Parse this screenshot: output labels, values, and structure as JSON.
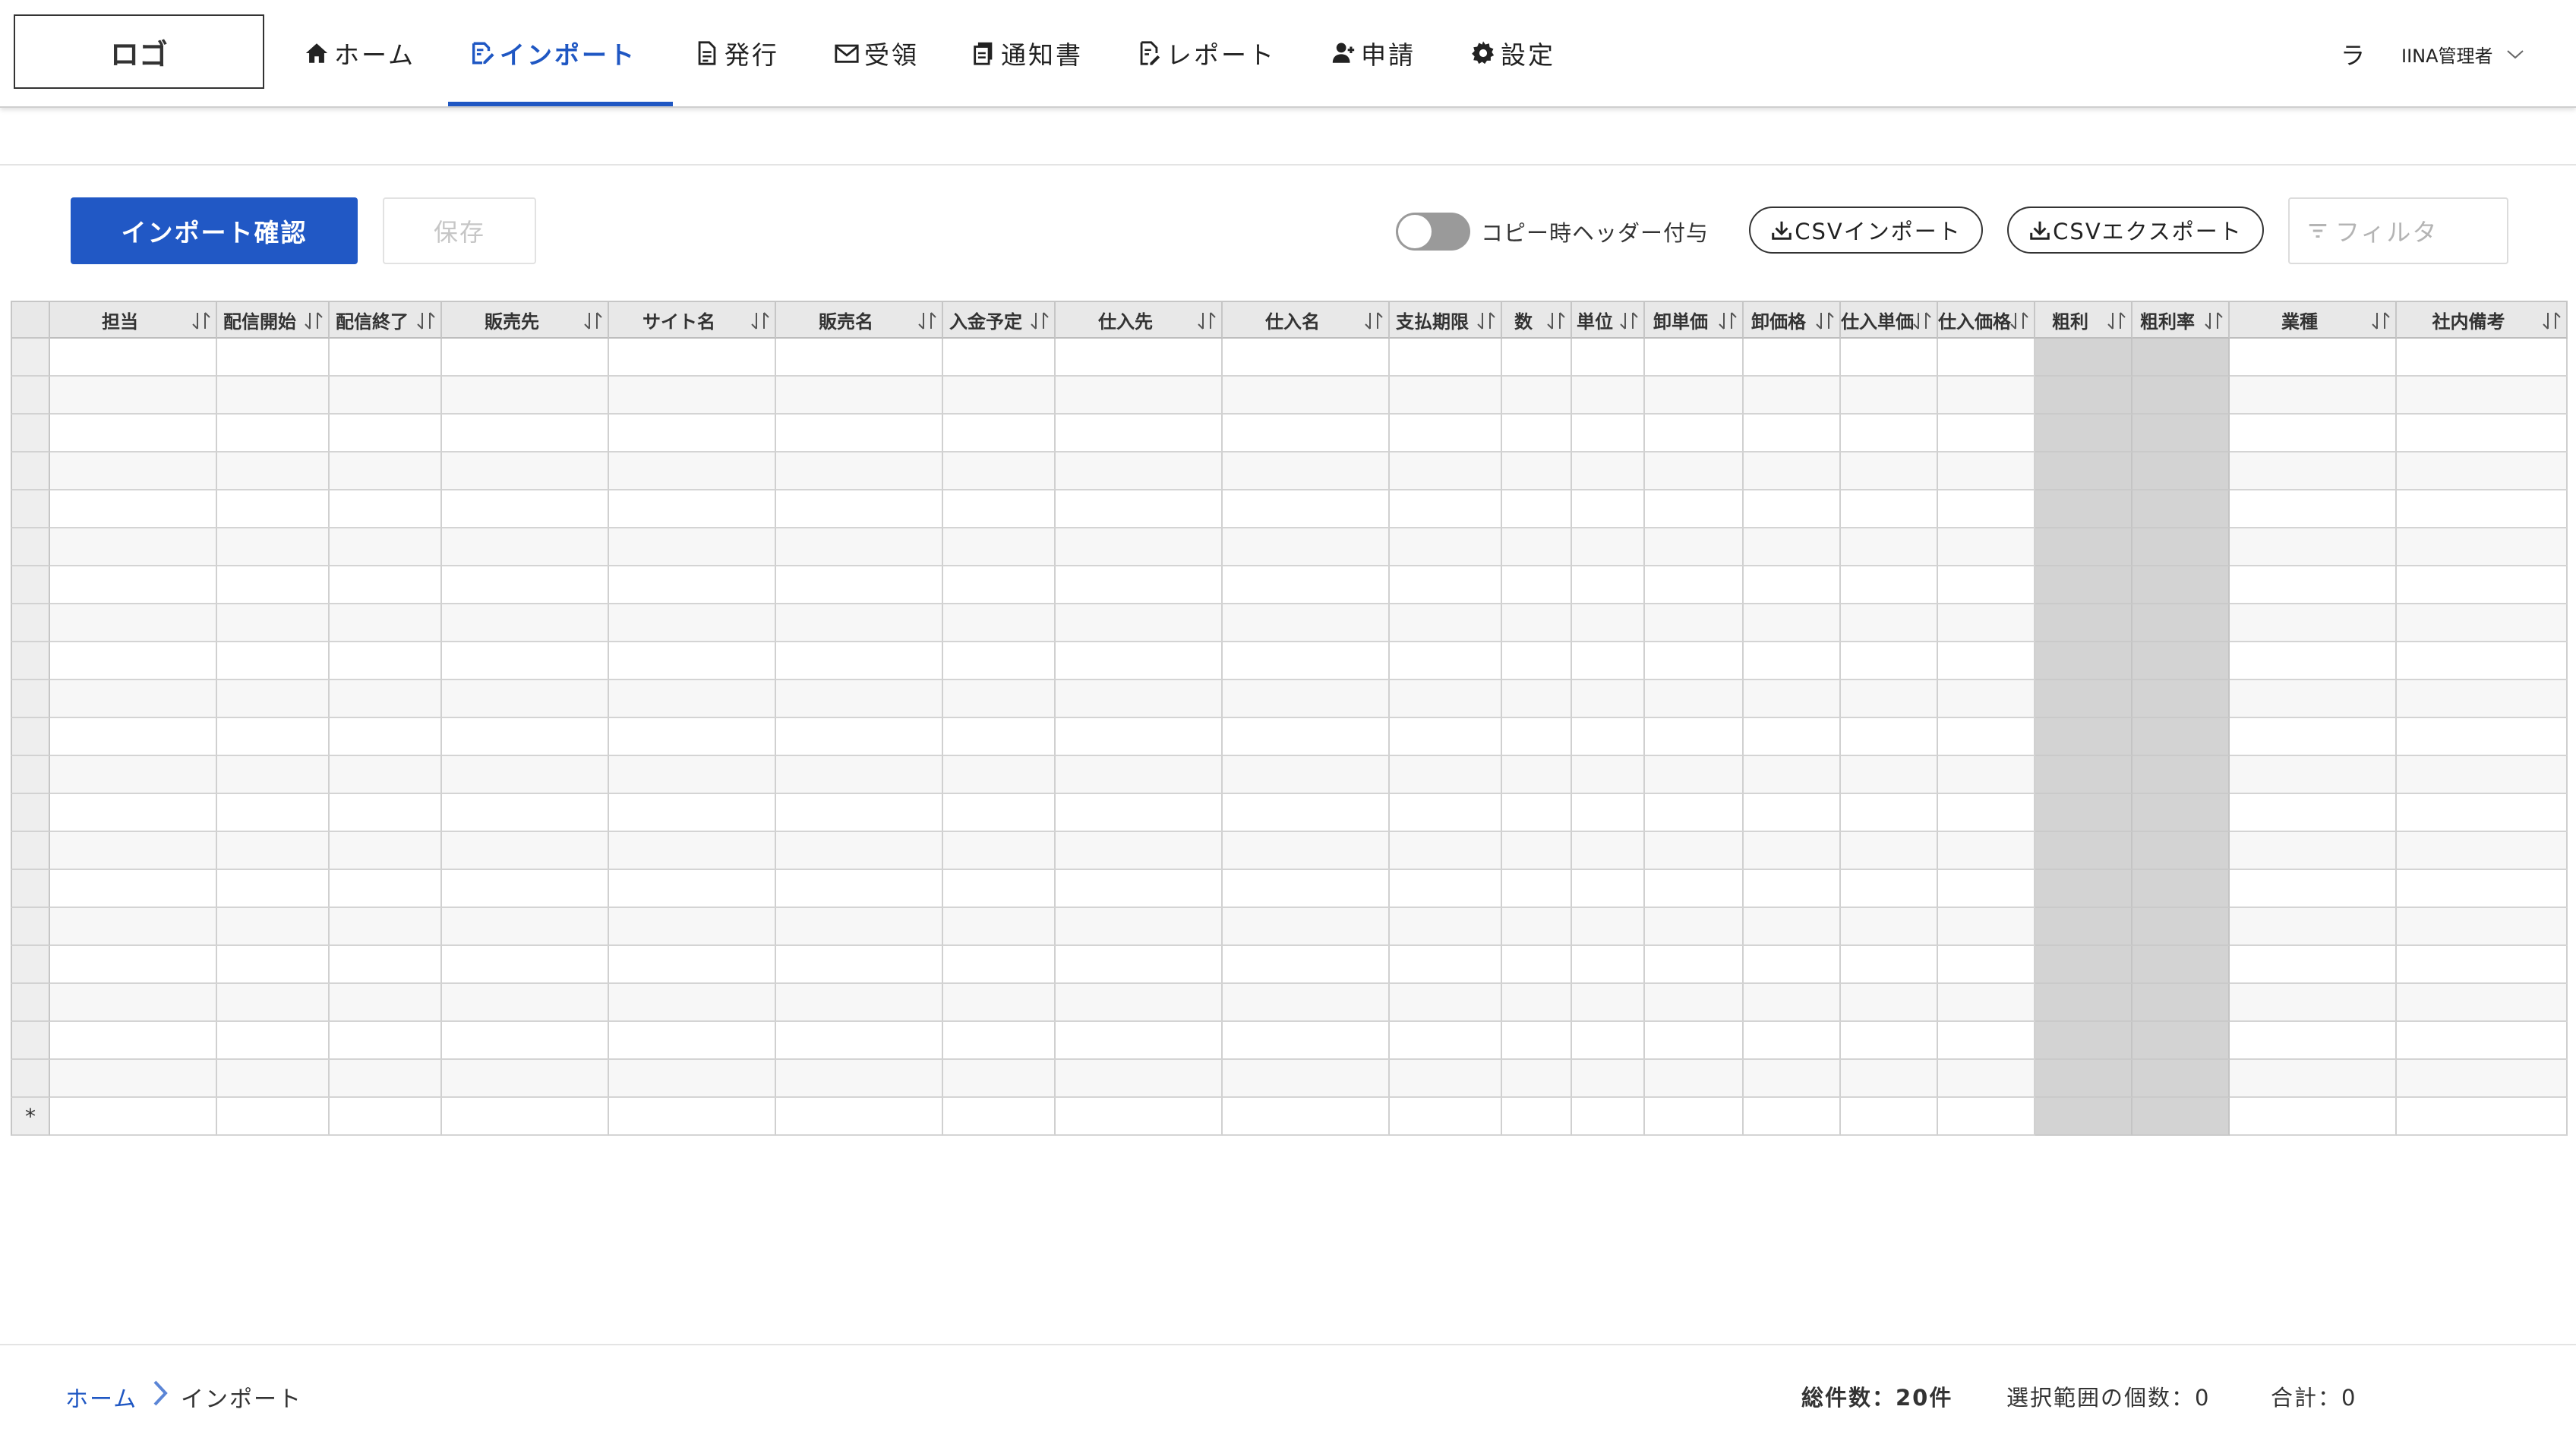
{
  "header": {
    "logo": "ロゴ",
    "nav": [
      {
        "label": "ホーム",
        "icon": "home-icon"
      },
      {
        "label": "インポート",
        "icon": "edit-document-icon",
        "active": true
      },
      {
        "label": "発行",
        "icon": "document-icon"
      },
      {
        "label": "受領",
        "icon": "envelope-icon"
      },
      {
        "label": "通知書",
        "icon": "copy-icon"
      },
      {
        "label": "レポート",
        "icon": "report-icon"
      },
      {
        "label": "申請",
        "icon": "user-plus-icon"
      },
      {
        "label": "設定",
        "icon": "gear-icon"
      }
    ],
    "lang": "ラ",
    "user": "IINA管理者"
  },
  "toolbar": {
    "import_confirm": "インポート確認",
    "save": "保存",
    "copy_toggle_label": "コピー時ヘッダー付与",
    "csv_import": "CSVインポート",
    "csv_export": "CSVエクスポート",
    "filter_placeholder": "フィルタ"
  },
  "grid": {
    "columns": [
      "担当",
      "配信開始",
      "配信終了",
      "販売先",
      "サイト名",
      "販売名",
      "入金予定",
      "仕入先",
      "仕入名",
      "支払期限",
      "数",
      "単位",
      "卸単価",
      "卸価格",
      "仕入単価",
      "仕入価格",
      "粗利",
      "粗利率",
      "業種",
      "社内備考"
    ],
    "shaded_columns": [
      "粗利",
      "粗利率"
    ],
    "row_count": 20,
    "new_row_marker": "*"
  },
  "footer": {
    "breadcrumb": [
      "ホーム",
      "インポート"
    ],
    "total": "総件数：20件",
    "selected": "選択範囲の個数：0",
    "sum": "合計：0"
  },
  "colors": {
    "accent": "#1f57c3",
    "primary_button": "#2158c5",
    "shaded_column": "#d3d3d3"
  }
}
